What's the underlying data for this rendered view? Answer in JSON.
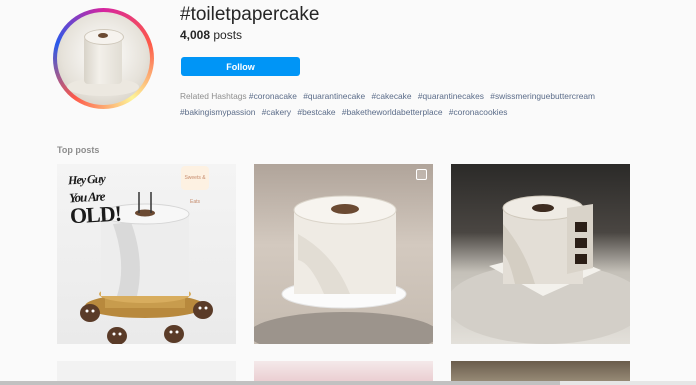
{
  "header": {
    "hashtag": "#toiletpapercake",
    "post_count": "4,008",
    "post_count_suffix": " posts",
    "follow_label": "Follow"
  },
  "related": {
    "label": "Related Hashtags",
    "tags": [
      "#coronacake",
      "#quarantinecake",
      "#cakecake",
      "#quarantinecakes",
      "#swissmeringuebuttercream",
      "#bakingismypassion",
      "#cakery",
      "#bestcake",
      "#baketheworldabetterplace",
      "#coronacookies"
    ]
  },
  "top_posts": {
    "label": "Top posts",
    "post1_topper_line1": "Hey Guy",
    "post1_topper_line2": "You Are",
    "post1_topper_line3": "OLD!",
    "post1_logo_text": "Sweets & Eats"
  },
  "colors": {
    "accent": "#0095f6",
    "link": "#5b6c89",
    "muted": "#8e8e8e"
  },
  "icons": {
    "multi_image": "checkbox-outline-icon"
  }
}
